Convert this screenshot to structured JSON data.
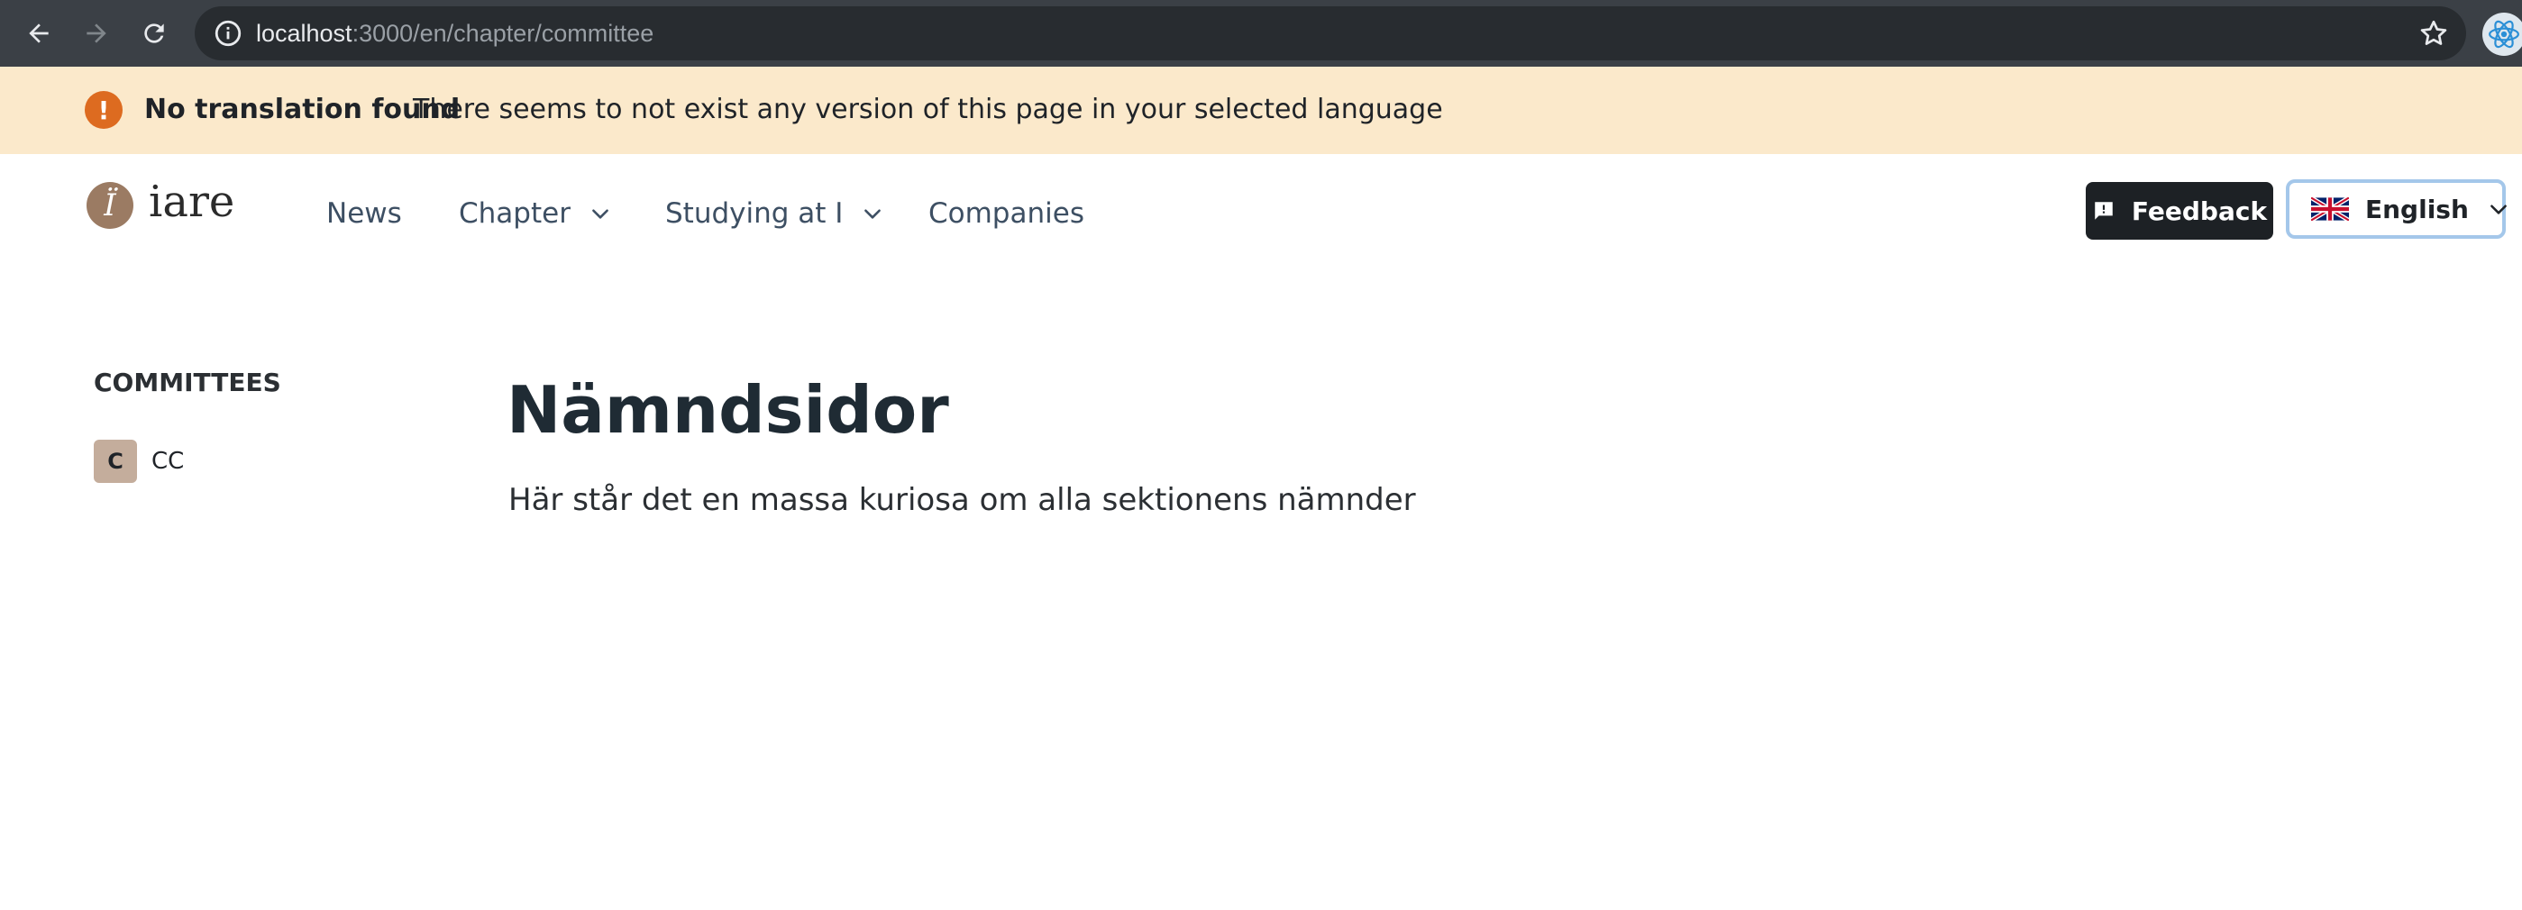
{
  "browser": {
    "url_host": "localhost",
    "url_path": ":3000/en/chapter/committee",
    "icons": [
      "back-arrow-icon",
      "forward-arrow-icon",
      "reload-icon",
      "site-info-icon",
      "star-icon",
      "react-devtools-icon"
    ]
  },
  "banner": {
    "title": "No translation found",
    "description": "There seems to not exist any version of this page in your selected language",
    "icon_glyph": "!",
    "background": "#fbe9cb",
    "icon_color": "#dd6b20"
  },
  "header": {
    "logo_text": "iare",
    "logo_glyph": "Ϊ",
    "nav": [
      {
        "label": "News"
      },
      {
        "label": "Chapter"
      },
      {
        "label": "Studying at I"
      },
      {
        "label": "Companies"
      }
    ],
    "feedback_label": "Feedback",
    "language_label": "English"
  },
  "sidebar": {
    "heading": "COMMITTEES",
    "items": [
      {
        "avatar": "C",
        "label": "CC"
      }
    ]
  },
  "main": {
    "title": "Nämndsidor",
    "description": "Här står det en massa kuriosa om alla sektionens nämnder"
  }
}
